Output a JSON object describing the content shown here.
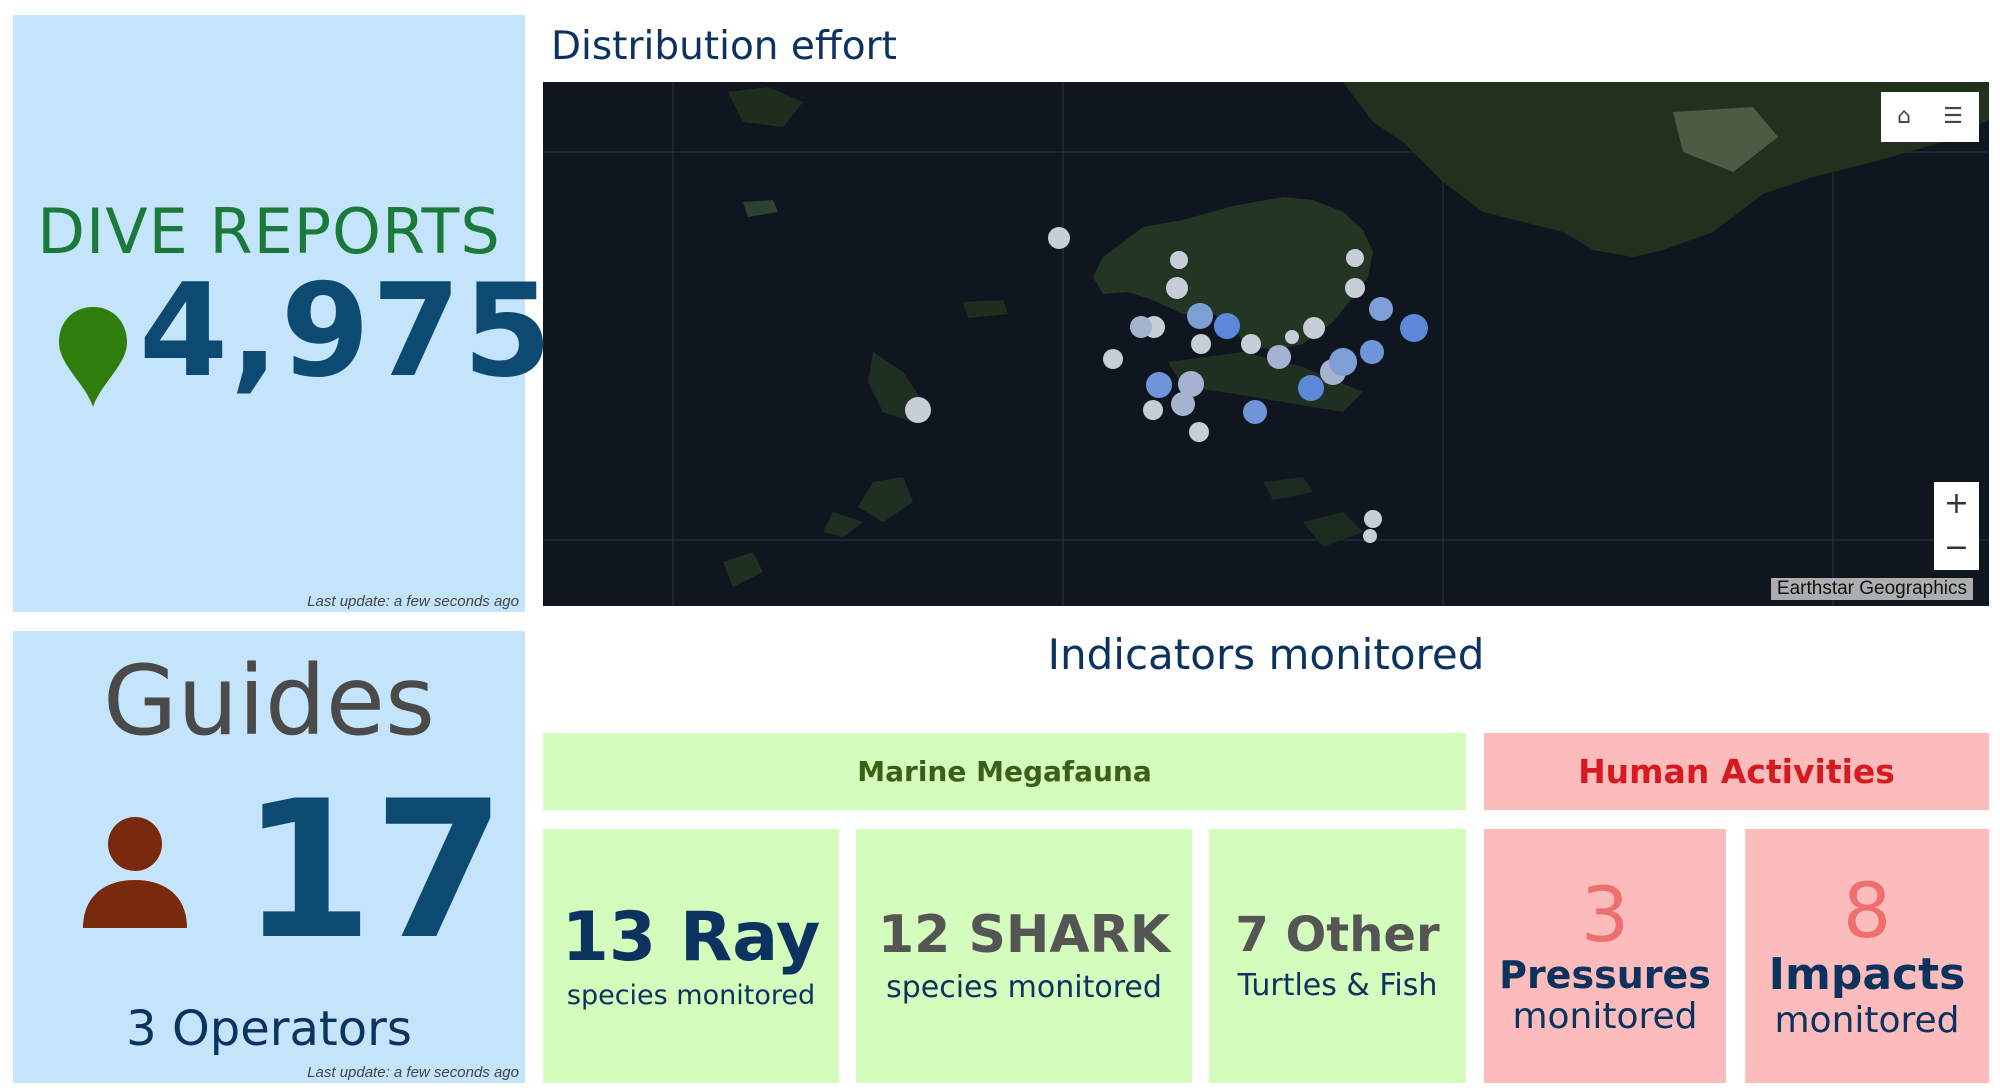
{
  "dive_reports": {
    "title": "DIVE REPORTS",
    "value": "4,975",
    "last_update": "Last update: a few seconds ago",
    "icon": "map-pin-icon",
    "color": "#1b7a3a"
  },
  "guides": {
    "title": "Guides",
    "value": "17",
    "operators": "3 Operators",
    "last_update": "Last update: a few seconds ago",
    "icon": "person-icon",
    "color": "#7a2a0c"
  },
  "map": {
    "title": "Distribution effort",
    "attribution": "Earthstar Geographics",
    "controls": {
      "home_icon": "home-icon",
      "legend_icon": "list-icon",
      "zoom_in": "+",
      "zoom_out": "−"
    }
  },
  "indicators": {
    "title": "Indicators monitored",
    "marine_megafauna": {
      "header": "Marine Megafauna",
      "ray": {
        "value": "13 Ray",
        "label": "species monitored"
      },
      "shark": {
        "value": "12 SHARK",
        "label": "species monitored"
      },
      "other": {
        "value": "7 Other",
        "label": "Turtles & Fish"
      }
    },
    "human_activities": {
      "header": "Human Activities",
      "pressures": {
        "value": "3",
        "title": "Pressures",
        "label": "monitored"
      },
      "impacts": {
        "value": "8",
        "title": "Impacts",
        "label": "monitored"
      }
    }
  }
}
